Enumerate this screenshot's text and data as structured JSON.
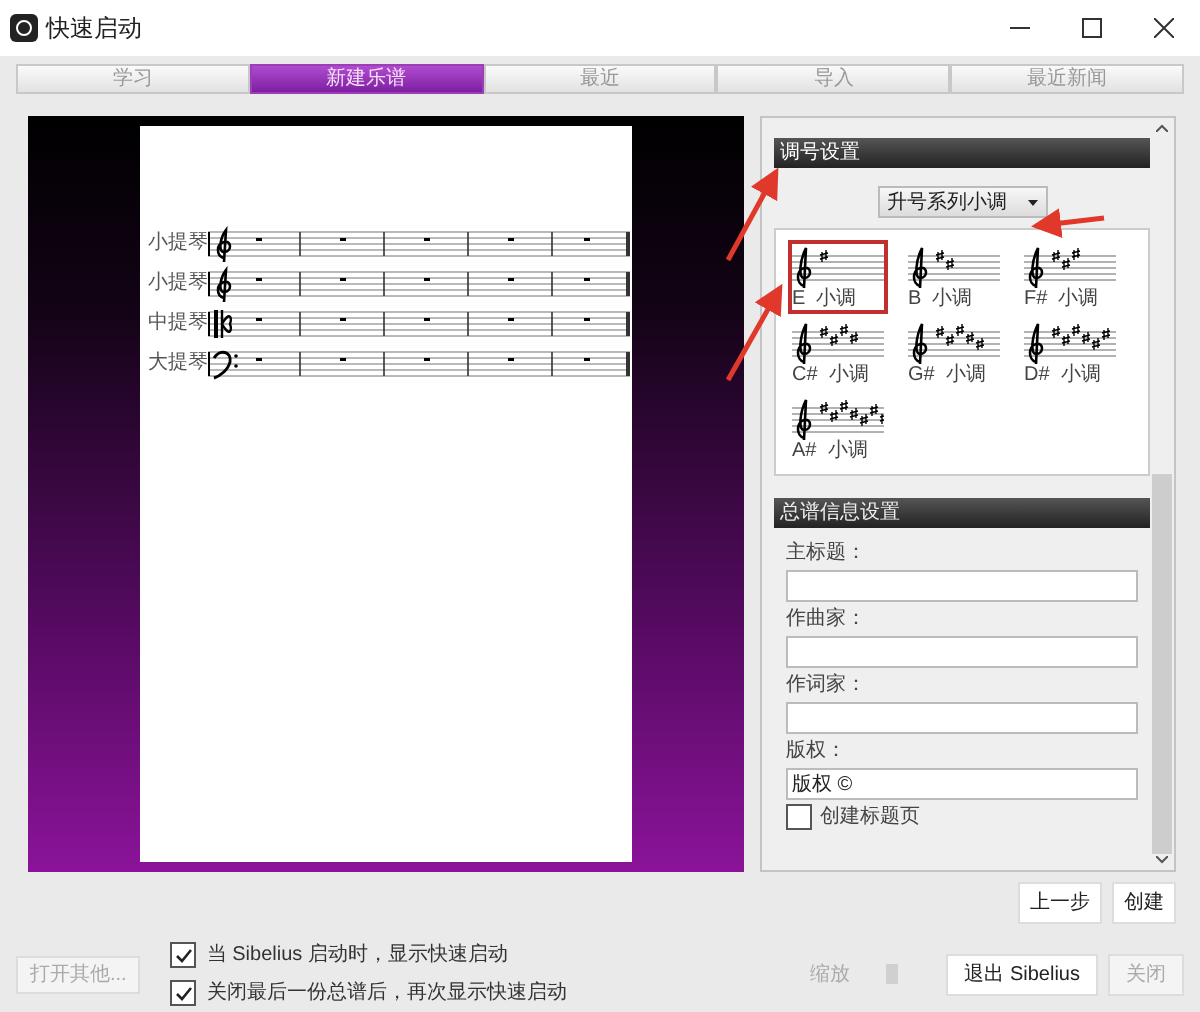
{
  "window": {
    "title": "快速启动"
  },
  "tabs": [
    {
      "label": "学习",
      "selected": false
    },
    {
      "label": "新建乐谱",
      "selected": true
    },
    {
      "label": "最近",
      "selected": false
    },
    {
      "label": "导入",
      "selected": false
    },
    {
      "label": "最近新闻",
      "selected": false
    }
  ],
  "score_preview": {
    "staves": [
      {
        "name": "小提琴",
        "kind": "treble"
      },
      {
        "name": "小提琴",
        "kind": "treble"
      },
      {
        "name": "中提琴",
        "kind": "alto"
      },
      {
        "name": "大提琴",
        "kind": "bass"
      }
    ]
  },
  "key_signature_section": {
    "title": "调号设置",
    "dropdown": "升号系列小调",
    "keys": [
      {
        "label": "E  小调",
        "selected": true
      },
      {
        "label": "B  小调",
        "selected": false
      },
      {
        "label": "F#  小调",
        "selected": false
      },
      {
        "label": "C#  小调",
        "selected": false
      },
      {
        "label": "G#  小调",
        "selected": false
      },
      {
        "label": "D#  小调",
        "selected": false
      },
      {
        "label": "A#  小调",
        "selected": false
      }
    ]
  },
  "score_info_section": {
    "title": "总谱信息设置",
    "fields": [
      {
        "label": "主标题："
      },
      {
        "label": "作曲家："
      },
      {
        "label": "作词家："
      },
      {
        "label": "版权：",
        "value": "版权 ©"
      }
    ],
    "title_page": {
      "label": "创建标题页",
      "checked": false
    }
  },
  "nav_buttons": [
    {
      "label": "上一步"
    },
    {
      "label": "创建"
    }
  ],
  "footer": {
    "open_other": {
      "label": "打开其他...",
      "disabled": true
    },
    "options": [
      {
        "label": "当 Sibelius 启动时，显示快速启动",
        "checked": true
      },
      {
        "label": "关闭最后一份总谱后，再次显示快速启动",
        "checked": true
      }
    ],
    "zoom": {
      "label": "缩放",
      "disabled": true
    },
    "buttons": [
      {
        "label": "退出 Sibelius",
        "disabled": false
      },
      {
        "label": "关闭",
        "disabled": true
      }
    ]
  }
}
